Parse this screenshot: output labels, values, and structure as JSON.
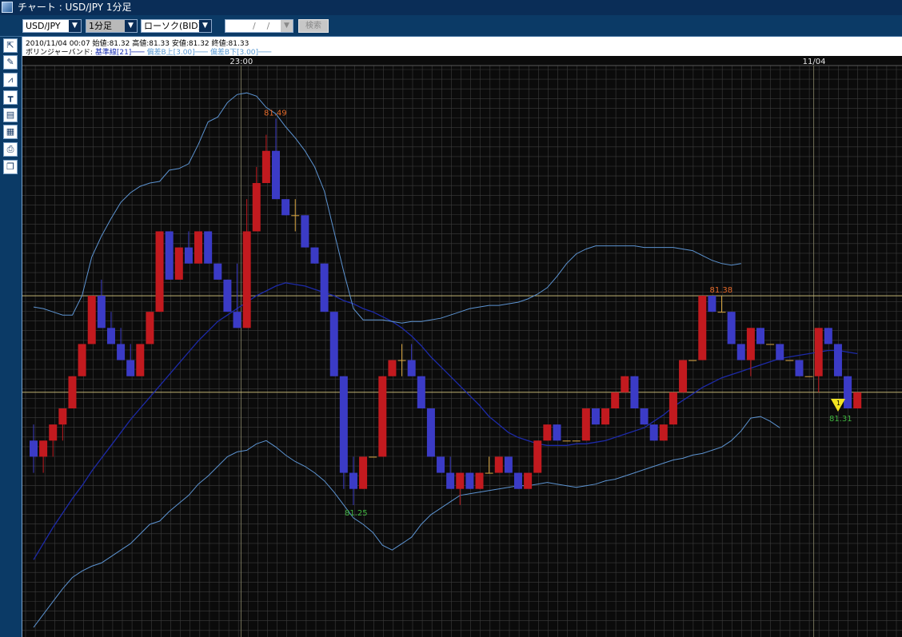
{
  "window": {
    "title": "チャート : USD/JPY 1分足"
  },
  "toolbar": {
    "symbol": "USD/JPY",
    "interval": "1分足",
    "chart_type": "ローソク(BID)",
    "date_value": "    /    /",
    "search_label": "検索",
    "dropdown_arrow": "▼"
  },
  "tools": [
    "pointer-tool-icon",
    "pencil-icon",
    "indicator-icon",
    "ruler-icon",
    "list-icon",
    "calendar-icon",
    "print-icon",
    "copy-icon"
  ],
  "info": {
    "ohlc": "2010/11/04 00:07  始値:81.32  高値:81.33  安値:81.32  終値:81.33",
    "bollinger_name": "ボリンジャーバンド:",
    "bollinger_mid": "基準線[21]───",
    "bollinger_up": "偏差B上[3.00]───",
    "bollinger_dn": "偏差B下[3.00]───"
  },
  "colors": {
    "up": "#c21a1f",
    "down": "#3b3bc6",
    "doji": "#d9a640",
    "band": "#5c93d1",
    "mid": "#1d2aa8",
    "grid": "#3c3c3c",
    "crosshair": "#d8c880",
    "high_label": "#e46a2a",
    "low_label": "#3fb33f",
    "marker": "#f2e421"
  },
  "chart_data": {
    "type": "candlestick",
    "x_ticks": [
      "23:00",
      "11/04"
    ],
    "high_label": "81.49",
    "high2_label": "81.38",
    "low_label": "81.25",
    "last_label": "81.31",
    "marker_label": "1",
    "ylim": [
      81.168,
      81.523
    ],
    "candles": [
      [
        81.29,
        81.3,
        81.27,
        81.28
      ],
      [
        81.28,
        81.29,
        81.27,
        81.29
      ],
      [
        81.29,
        81.3,
        81.28,
        81.3
      ],
      [
        81.3,
        81.31,
        81.29,
        81.31
      ],
      [
        81.31,
        81.33,
        81.31,
        81.33
      ],
      [
        81.33,
        81.35,
        81.33,
        81.35
      ],
      [
        81.35,
        81.38,
        81.35,
        81.38
      ],
      [
        81.38,
        81.39,
        81.36,
        81.36
      ],
      [
        81.36,
        81.37,
        81.35,
        81.35
      ],
      [
        81.35,
        81.36,
        81.34,
        81.34
      ],
      [
        81.34,
        81.35,
        81.33,
        81.33
      ],
      [
        81.33,
        81.35,
        81.33,
        81.35
      ],
      [
        81.35,
        81.37,
        81.35,
        81.37
      ],
      [
        81.37,
        81.42,
        81.37,
        81.42
      ],
      [
        81.42,
        81.42,
        81.39,
        81.39
      ],
      [
        81.39,
        81.41,
        81.39,
        81.41
      ],
      [
        81.41,
        81.42,
        81.4,
        81.4
      ],
      [
        81.4,
        81.42,
        81.4,
        81.42
      ],
      [
        81.42,
        81.42,
        81.4,
        81.4
      ],
      [
        81.4,
        81.4,
        81.39,
        81.39
      ],
      [
        81.39,
        81.39,
        81.37,
        81.37
      ],
      [
        81.37,
        81.4,
        81.36,
        81.36
      ],
      [
        81.36,
        81.44,
        81.36,
        81.42
      ],
      [
        81.42,
        81.46,
        81.42,
        81.45
      ],
      [
        81.45,
        81.48,
        81.45,
        81.47
      ],
      [
        81.47,
        81.49,
        81.44,
        81.44
      ],
      [
        81.44,
        81.44,
        81.43,
        81.43
      ],
      [
        81.43,
        81.44,
        81.42,
        81.43
      ],
      [
        81.43,
        81.43,
        81.41,
        81.41
      ],
      [
        81.41,
        81.41,
        81.4,
        81.4
      ],
      [
        81.4,
        81.4,
        81.37,
        81.37
      ],
      [
        81.37,
        81.37,
        81.33,
        81.33
      ],
      [
        81.33,
        81.33,
        81.26,
        81.27
      ],
      [
        81.27,
        81.28,
        81.25,
        81.26
      ],
      [
        81.26,
        81.28,
        81.26,
        81.28
      ],
      [
        81.28,
        81.28,
        81.28,
        81.28
      ],
      [
        81.28,
        81.33,
        81.28,
        81.33
      ],
      [
        81.33,
        81.34,
        81.33,
        81.34
      ],
      [
        81.34,
        81.35,
        81.33,
        81.34
      ],
      [
        81.34,
        81.35,
        81.33,
        81.33
      ],
      [
        81.33,
        81.33,
        81.31,
        81.31
      ],
      [
        81.31,
        81.31,
        81.28,
        81.28
      ],
      [
        81.28,
        81.28,
        81.27,
        81.27
      ],
      [
        81.27,
        81.28,
        81.26,
        81.26
      ],
      [
        81.26,
        81.27,
        81.25,
        81.27
      ],
      [
        81.27,
        81.27,
        81.26,
        81.26
      ],
      [
        81.26,
        81.27,
        81.26,
        81.27
      ],
      [
        81.27,
        81.28,
        81.27,
        81.27
      ],
      [
        81.27,
        81.28,
        81.27,
        81.28
      ],
      [
        81.28,
        81.28,
        81.27,
        81.27
      ],
      [
        81.27,
        81.27,
        81.26,
        81.26
      ],
      [
        81.26,
        81.26,
        81.26,
        81.27
      ],
      [
        81.27,
        81.29,
        81.27,
        81.29
      ],
      [
        81.29,
        81.3,
        81.29,
        81.3
      ],
      [
        81.3,
        81.3,
        81.29,
        81.29
      ],
      [
        81.29,
        81.29,
        81.29,
        81.29
      ],
      [
        81.29,
        81.29,
        81.29,
        81.29
      ],
      [
        81.29,
        81.31,
        81.29,
        81.31
      ],
      [
        81.31,
        81.31,
        81.3,
        81.3
      ],
      [
        81.3,
        81.31,
        81.3,
        81.31
      ],
      [
        81.31,
        81.32,
        81.31,
        81.32
      ],
      [
        81.32,
        81.33,
        81.32,
        81.33
      ],
      [
        81.33,
        81.33,
        81.31,
        81.31
      ],
      [
        81.31,
        81.31,
        81.3,
        81.3
      ],
      [
        81.3,
        81.3,
        81.29,
        81.29
      ],
      [
        81.29,
        81.3,
        81.29,
        81.3
      ],
      [
        81.3,
        81.32,
        81.3,
        81.32
      ],
      [
        81.32,
        81.34,
        81.32,
        81.34
      ],
      [
        81.34,
        81.34,
        81.34,
        81.34
      ],
      [
        81.34,
        81.38,
        81.34,
        81.38
      ],
      [
        81.38,
        81.38,
        81.37,
        81.37
      ],
      [
        81.37,
        81.38,
        81.37,
        81.37
      ],
      [
        81.37,
        81.37,
        81.35,
        81.35
      ],
      [
        81.35,
        81.35,
        81.34,
        81.34
      ],
      [
        81.34,
        81.36,
        81.33,
        81.36
      ],
      [
        81.36,
        81.36,
        81.35,
        81.35
      ],
      [
        81.35,
        81.35,
        81.35,
        81.35
      ],
      [
        81.35,
        81.35,
        81.35,
        81.34
      ],
      [
        81.34,
        81.34,
        81.34,
        81.34
      ],
      [
        81.34,
        81.34,
        81.33,
        81.33
      ],
      [
        81.33,
        81.33,
        81.33,
        81.33
      ],
      [
        81.33,
        81.36,
        81.32,
        81.36
      ],
      [
        81.36,
        81.36,
        81.35,
        81.35
      ],
      [
        81.35,
        81.35,
        81.33,
        81.33
      ],
      [
        81.33,
        81.33,
        81.31,
        81.31
      ],
      [
        81.31,
        81.32,
        81.31,
        81.32
      ]
    ],
    "mid": [
      81.216,
      81.226,
      81.236,
      81.245,
      81.254,
      81.262,
      81.271,
      81.279,
      81.287,
      81.295,
      81.303,
      81.31,
      81.317,
      81.324,
      81.331,
      81.338,
      81.345,
      81.352,
      81.358,
      81.364,
      81.368,
      81.372,
      81.376,
      81.38,
      81.383,
      81.386,
      81.388,
      81.387,
      81.386,
      81.384,
      81.382,
      81.38,
      81.377,
      81.375,
      81.372,
      81.37,
      81.367,
      81.364,
      81.36,
      81.355,
      81.349,
      81.342,
      81.336,
      81.33,
      81.324,
      81.318,
      81.312,
      81.305,
      81.3,
      81.295,
      81.292,
      81.29,
      81.288,
      81.287,
      81.287,
      81.287,
      81.288,
      81.288,
      81.289,
      81.29,
      81.292,
      81.294,
      81.296,
      81.298,
      81.302,
      81.306,
      81.311,
      81.315,
      81.319,
      81.323,
      81.326,
      81.329,
      81.331,
      81.333,
      81.335,
      81.337,
      81.339,
      81.341,
      81.342,
      81.343,
      81.344,
      81.345,
      81.346,
      81.346,
      81.345,
      81.344
    ],
    "upper": [
      81.373,
      81.372,
      81.37,
      81.368,
      81.368,
      81.38,
      81.404,
      81.417,
      81.428,
      81.438,
      81.444,
      81.448,
      81.45,
      81.451,
      81.458,
      81.459,
      81.462,
      81.474,
      81.488,
      81.491,
      81.5,
      81.505,
      81.506,
      81.504,
      81.497,
      81.493,
      81.485,
      81.478,
      81.47,
      81.46,
      81.445,
      81.42,
      81.395,
      81.372,
      81.365,
      81.365,
      81.365,
      81.364,
      81.363,
      81.364,
      81.364,
      81.365,
      81.366,
      81.368,
      81.37,
      81.372,
      81.373,
      81.374,
      81.374,
      81.375,
      81.376,
      81.378,
      81.381,
      81.385,
      81.392,
      81.4,
      81.406,
      81.409,
      81.411,
      81.411,
      81.411,
      81.411,
      81.411,
      81.41,
      81.41,
      81.41,
      81.41,
      81.409,
      81.408,
      81.405,
      81.402,
      81.4,
      81.399,
      81.4
    ],
    "lower": [
      81.174,
      81.182,
      81.19,
      81.198,
      81.205,
      81.209,
      81.212,
      81.214,
      81.218,
      81.222,
      81.226,
      81.232,
      81.238,
      81.24,
      81.246,
      81.251,
      81.256,
      81.263,
      81.268,
      81.274,
      81.28,
      81.283,
      81.284,
      81.288,
      81.29,
      81.286,
      81.281,
      81.277,
      81.274,
      81.27,
      81.265,
      81.258,
      81.25,
      81.242,
      81.238,
      81.233,
      81.225,
      81.222,
      81.226,
      81.23,
      81.238,
      81.244,
      81.248,
      81.252,
      81.256,
      81.257,
      81.258,
      81.259,
      81.26,
      81.261,
      81.262,
      81.262,
      81.263,
      81.264,
      81.263,
      81.262,
      81.261,
      81.262,
      81.263,
      81.265,
      81.266,
      81.268,
      81.27,
      81.272,
      81.274,
      81.276,
      81.278,
      81.279,
      81.281,
      81.282,
      81.284,
      81.286,
      81.29,
      81.296,
      81.304,
      81.305,
      81.302,
      81.298
    ]
  }
}
